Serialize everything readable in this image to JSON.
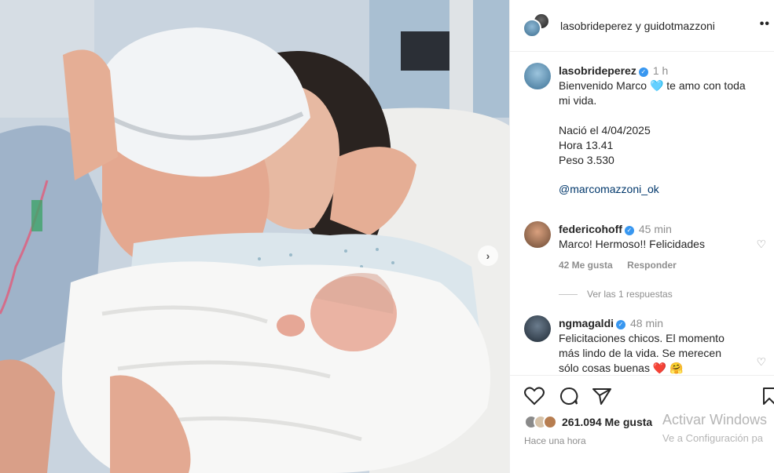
{
  "post_header": {
    "title": "lasobrideperez y guidotmazzoni",
    "more_label": "••"
  },
  "caption": {
    "username": "lasobrideperez",
    "time": "1 h",
    "line1": "Bienvenido Marco 🩵 te amo con toda",
    "line2": "mi vida.",
    "line3": "Nació el 4/04/2025",
    "line4": "Hora 13.41",
    "line5": "Peso 3.530",
    "mention": "@marcomazzoni_ok"
  },
  "comments": [
    {
      "username": "federicohoff",
      "time": "45 min",
      "text": "Marco! Hermoso!! Felicidades",
      "likes": "42 Me gusta",
      "reply_label": "Responder",
      "view_replies": "Ver las 1 respuestas"
    },
    {
      "username": "ngmagaldi",
      "time": "48 min",
      "line1": "Felicitaciones chicos. El momento",
      "line2": "más lindo de la vida. Se merecen",
      "line3": "sólo cosas buenas ❤️ 🤗"
    }
  ],
  "actions": {
    "likes_count": "261.094 Me gusta",
    "posted_time": "Hace una hora"
  },
  "watermark": {
    "line1": "Activar Windows",
    "line2": "Ve a Configuración pa"
  },
  "photo": {
    "next_label": "›"
  }
}
